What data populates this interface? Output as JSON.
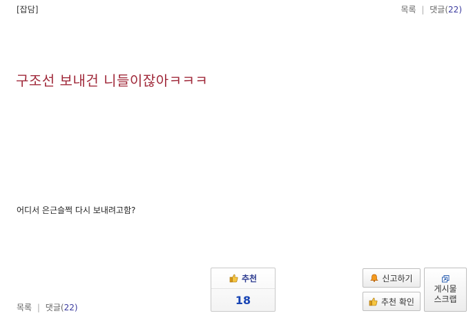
{
  "post": {
    "category": "[잡담]",
    "title": "구조선 보내건 니들이잖아ㅋㅋㅋ",
    "body": "어디서 은근슬쩍 다시 보내려고함?"
  },
  "links": {
    "list": "목록",
    "separator": "|",
    "comments_label": "댓글(",
    "comments_count": "22",
    "comments_close": ")"
  },
  "recommend": {
    "label": "추천",
    "count": "18"
  },
  "buttons": {
    "report": "신고하기",
    "confirm_recommend": "추천 확인",
    "scrap_line1": "게시물",
    "scrap_line2": "스크랩"
  },
  "icons": {
    "recommend": "thumbs-up-icon",
    "report": "bell-icon",
    "confirm": "thumbs-up-icon",
    "scrap": "scrap-icon"
  }
}
